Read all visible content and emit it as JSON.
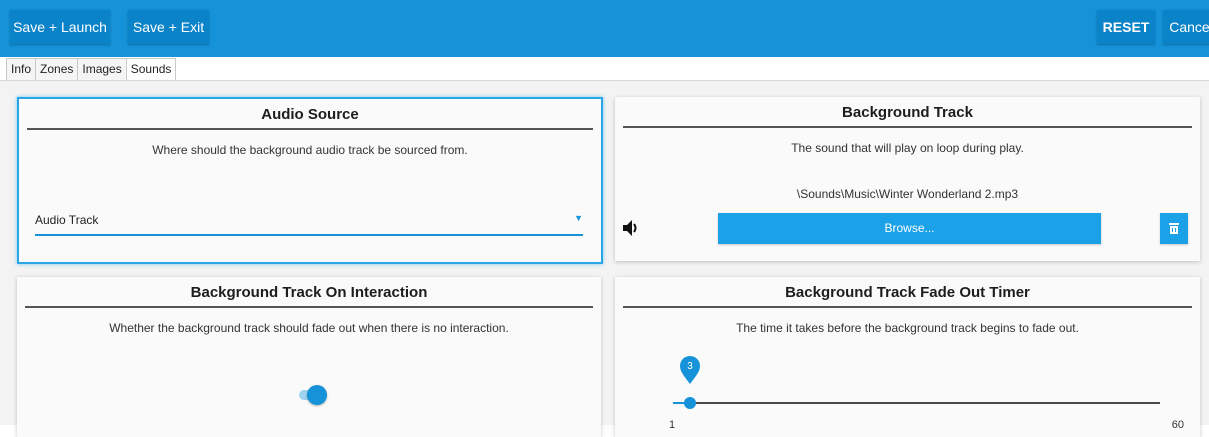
{
  "toolbar": {
    "save_launch": "Save + Launch",
    "save_exit": "Save + Exit",
    "reset": "RESET",
    "cancel": "Cancel"
  },
  "tabs": [
    "Info",
    "Zones",
    "Images",
    "Sounds"
  ],
  "active_tab": "Sounds",
  "cards": {
    "audio_source": {
      "title": "Audio Source",
      "description": "Where should the background audio track be sourced from.",
      "selected": "Audio Track",
      "icon": "chevron-down-icon"
    },
    "background_track": {
      "title": "Background Track",
      "description": "The sound that will play on loop during play.",
      "file_path": "\\Sounds\\Music\\Winter Wonderland 2.mp3",
      "browse_label": "Browse...",
      "icons": [
        "speaker-icon",
        "trash-icon"
      ]
    },
    "on_interaction": {
      "title": "Background Track On Interaction",
      "description": "Whether the background track should fade out when there is no interaction.",
      "toggle_on": true
    },
    "fade_out_timer": {
      "title": "Background Track Fade Out Timer",
      "description": "The time it takes before the background track begins to fade out.",
      "value": "3",
      "min": "1",
      "max": "60"
    }
  },
  "colors": {
    "accent": "#1592d8",
    "button": "#1aa1e8",
    "toolbar": "#1592d8"
  }
}
